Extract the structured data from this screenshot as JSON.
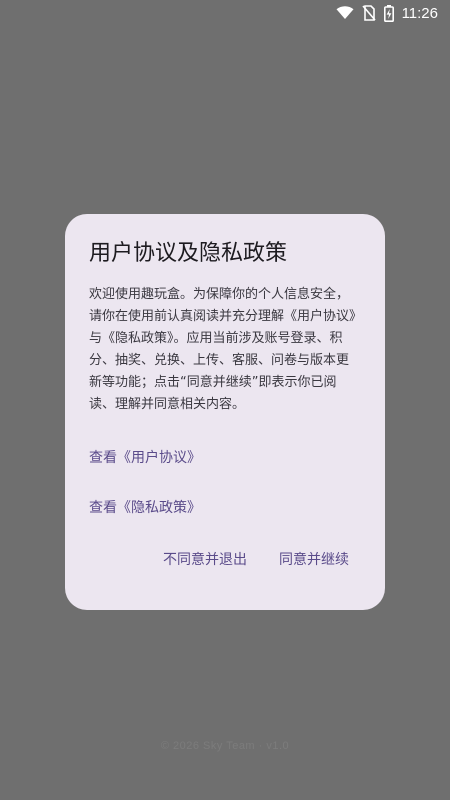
{
  "status_bar": {
    "time": "11:26",
    "icons": [
      "wifi-icon",
      "no-sim-icon",
      "battery-charging-icon"
    ]
  },
  "dialog": {
    "title": "用户协议及隐私政策",
    "body": "欢迎使用趣玩盒。为保障你的个人信息安全，请你在使用前认真阅读并充分理解《用户协议》与《隐私政策》。应用当前涉及账号登录、积分、抽奖、兑换、上传、客服、问卷与版本更新等功能；点击“同意并继续”即表示你已阅读、理解并同意相关内容。",
    "links": {
      "user_agreement": "查看《用户协议》",
      "privacy_policy": "查看《隐私政策》"
    },
    "buttons": {
      "decline": "不同意并退出",
      "accept": "同意并继续"
    }
  },
  "footer": {
    "text": "© 2026 Sky Team · v1.0"
  },
  "colors": {
    "scrim": "#6f6f6f",
    "dialog_bg": "#ece6f0",
    "accent": "#5a4b8a",
    "title": "#1d1b20"
  }
}
